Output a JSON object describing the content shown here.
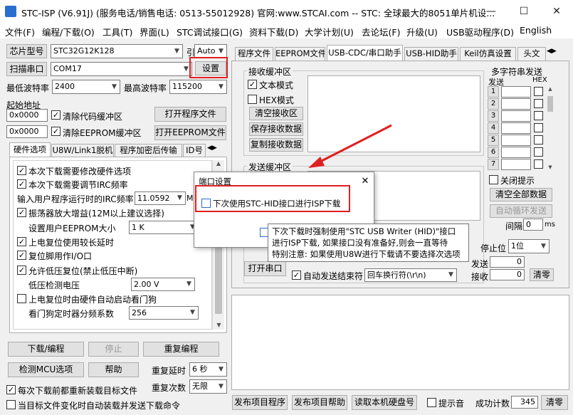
{
  "app": {
    "title": "STC-ISP (V6.91J) (服务电话/销售电话: 0513-55012928) 官网:www.STCAI.com  -- STC: 全球最大的8051单片机设..."
  },
  "window": {
    "minimize": "—",
    "maximize": "☐",
    "close": "✕"
  },
  "menu": [
    "文件(F)",
    "编程/下载(O)",
    "工具(T)",
    "界面(L)",
    "STC调试接口(G)",
    "资料下载(D)",
    "大学计划(U)",
    "去论坛(F)",
    "升级(U)",
    "USB驱动程序(D)",
    "English"
  ],
  "left": {
    "chip_label": "芯片型号",
    "chip_value": "STC32G12K128",
    "pin_label": "引脚数",
    "pin_value": "Auto",
    "scan_label": "扫描串口",
    "port_value": "COM17",
    "settings_label": "设置",
    "min_baud_label": "最低波特率",
    "min_baud": "2400",
    "max_baud_label": "最高波特率",
    "max_baud": "115200",
    "start_addr_label": "起始地址",
    "addr1": "0x0000",
    "clear_code": "清除代码缓冲区",
    "open_prog": "打开程序文件",
    "addr2": "0x0000",
    "clear_eeprom": "清除EEPROM缓冲区",
    "open_eeprom": "打开EEPROM文件",
    "tabs": [
      "硬件选项",
      "U8W/Link1脱机",
      "程序加密后传输",
      "ID号"
    ],
    "options": [
      {
        "text": "本次下载需要修改硬件选项",
        "checked": true
      },
      {
        "text": "本次下载需要调节IRC频率",
        "checked": true
      },
      {
        "text": "输入用户程序运行时的IRC频率",
        "value": "11.0592",
        "unit": "MH"
      },
      {
        "text": "振荡器放大增益(12M以上建议选择)",
        "checked": true
      },
      {
        "text": "设置用户EEPROM大小",
        "value": "1  K"
      },
      {
        "text": "上电复位使用较长延时",
        "checked": true
      },
      {
        "text": "复位脚用作I/O口",
        "checked": true
      },
      {
        "text": "允许低压复位(禁止低压中断)",
        "checked": true
      },
      {
        "text": "低压检测电压",
        "value": "2.00 V"
      },
      {
        "text": "上电复位时由硬件自动启动看门狗",
        "checked": false
      },
      {
        "text": "看门狗定时器分频系数",
        "value": "256"
      }
    ],
    "download": "下载/编程",
    "stop": "停止",
    "reprog": "重复编程",
    "detect": "检测MCU选项",
    "help": "帮助",
    "delay_label": "重复延时",
    "delay_value": "6 秒",
    "count_label": "重复次数",
    "count_value": "无限",
    "reload": "每次下载前都重新装载目标文件",
    "auto_send": "当目标文件变化时自动装载并发送下载命令"
  },
  "right": {
    "tabs": [
      "程序文件",
      "EEPROM文件",
      "USB-CDC/串口助手",
      "USB-HID助手",
      "Keil仿真设置",
      "头文"
    ],
    "recv_title": "接收缓冲区",
    "text_mode": "文本模式",
    "hex_mode": "HEX模式",
    "clear_recv": "清空接收区",
    "save_recv": "保存接收数据",
    "copy_recv": "复制接收数据",
    "send_title": "发送缓冲区",
    "open_port": "打开串口",
    "auto_end": "自动发送结束符",
    "end_value": "回车换行符(\\r\\n)",
    "stop_label": "停止位",
    "stop_value": "1位",
    "send_label": "发送",
    "send_count": "0",
    "recv_label": "接收",
    "recv_count": "0",
    "clear": "清零",
    "multi_title": "多字符串发送",
    "send_col": "发送",
    "hex_col": "HEX",
    "rows": [
      "1",
      "2",
      "3",
      "4",
      "5",
      "6",
      "7"
    ],
    "close_tip": "关闭提示",
    "clear_all": "清空全部数据",
    "auto_loop": "自动循环发送",
    "interval_label": "间隔",
    "interval_value": "0",
    "interval_unit": "ms",
    "publish": "发布项目程序",
    "publish_help": "发布项目帮助",
    "read_disk": "读取本机硬盘号",
    "tone": "提示音",
    "success_label": "成功计数",
    "success_value": "345",
    "clear2": "清零"
  },
  "popup": {
    "title": "端口设置",
    "close": "✕",
    "option": "下次使用STC-HID接口进行ISP下载"
  },
  "tooltip": {
    "line1": "下次下载时强制使用\"STC USB Writer (HID)\"接口",
    "line2": "进行ISP下载, 如果接口没有准备好,则会一直等待",
    "line3": "特别注意: 如果使用U8W进行下载请不要选择次选项"
  }
}
